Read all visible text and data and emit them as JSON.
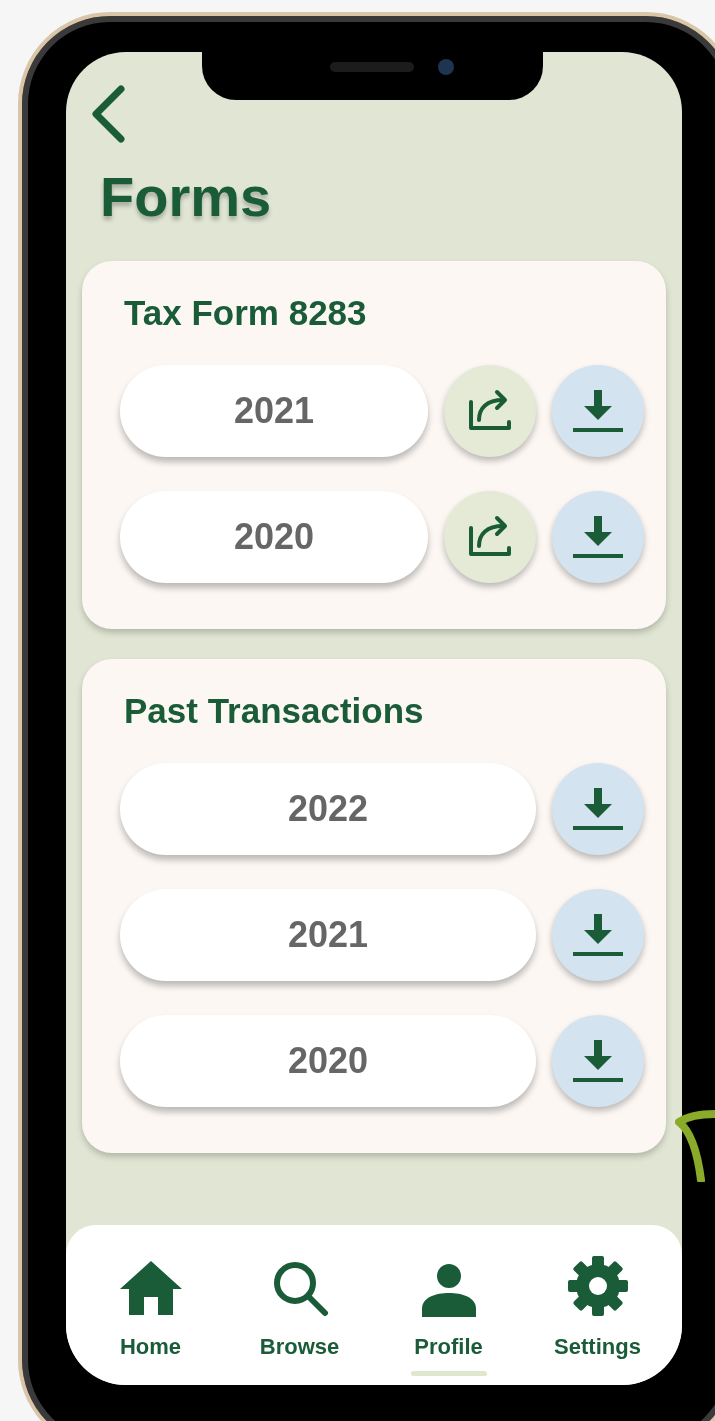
{
  "title": "Forms",
  "sections": [
    {
      "title": "Tax Form 8283",
      "rows": [
        {
          "year": "2021",
          "actions": [
            {
              "kind": "share"
            },
            {
              "kind": "download"
            }
          ]
        },
        {
          "year": "2020",
          "actions": [
            {
              "kind": "share"
            },
            {
              "kind": "download"
            }
          ]
        }
      ]
    },
    {
      "title": "Past Transactions",
      "rows": [
        {
          "year": "2022",
          "actions": [
            {
              "kind": "download"
            }
          ]
        },
        {
          "year": "2021",
          "actions": [
            {
              "kind": "download"
            }
          ]
        },
        {
          "year": "2020",
          "actions": [
            {
              "kind": "download"
            }
          ]
        }
      ]
    }
  ],
  "nav": [
    {
      "kind": "home",
      "label": "Home",
      "selected": false
    },
    {
      "kind": "search",
      "label": "Browse",
      "selected": false
    },
    {
      "kind": "profile",
      "label": "Profile",
      "selected": true
    },
    {
      "kind": "settings",
      "label": "Settings",
      "selected": false
    }
  ]
}
